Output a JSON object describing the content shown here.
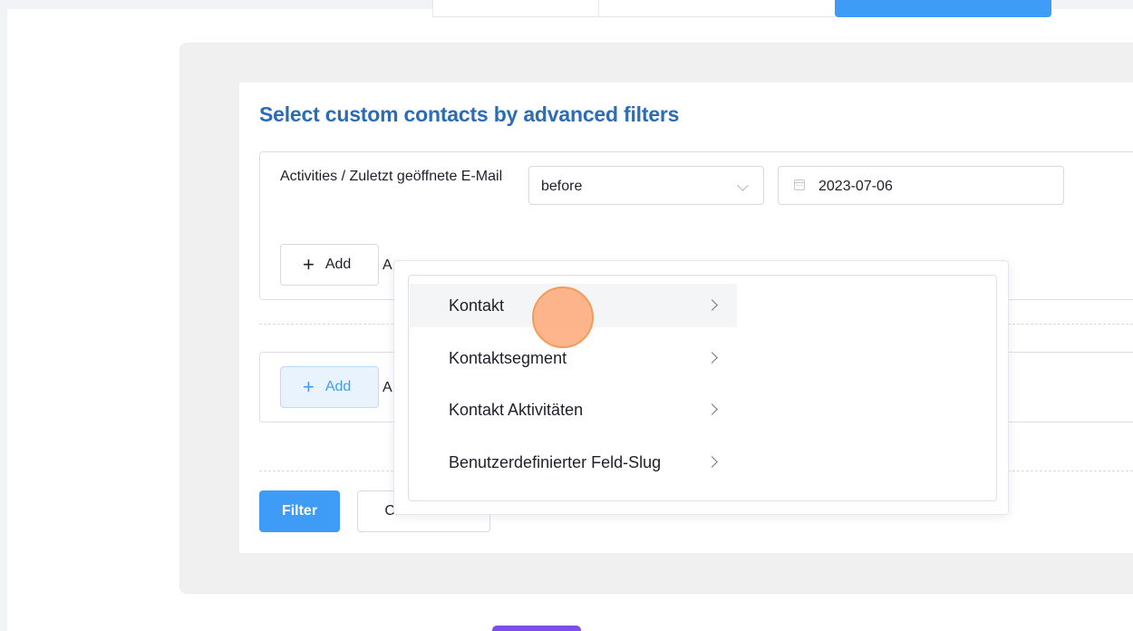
{
  "card": {
    "title": "Select custom contacts by advanced filters"
  },
  "filter_group_1": {
    "label": "Activities / Zuletzt geöffnete E-Mail",
    "operator": "before",
    "date_value": "2023-07-06",
    "add_label": "Add",
    "helper_text_visible": "A"
  },
  "filter_group_2": {
    "add_label": "Add",
    "helper_text_visible": "A"
  },
  "actions": {
    "filter_label": "Filter",
    "clear_label": "Clear Filters"
  },
  "dropdown": {
    "items": [
      {
        "label": "Kontakt"
      },
      {
        "label": "Kontaktsegment"
      },
      {
        "label": "Kontakt Aktivitäten"
      },
      {
        "label": "Benutzerdefinierter Feld-Slug"
      }
    ]
  },
  "colors": {
    "primary": "#3f9cf6",
    "title": "#2b6cb7",
    "accent_purple": "#7b4fe8",
    "cursor": "#f59a5c"
  }
}
